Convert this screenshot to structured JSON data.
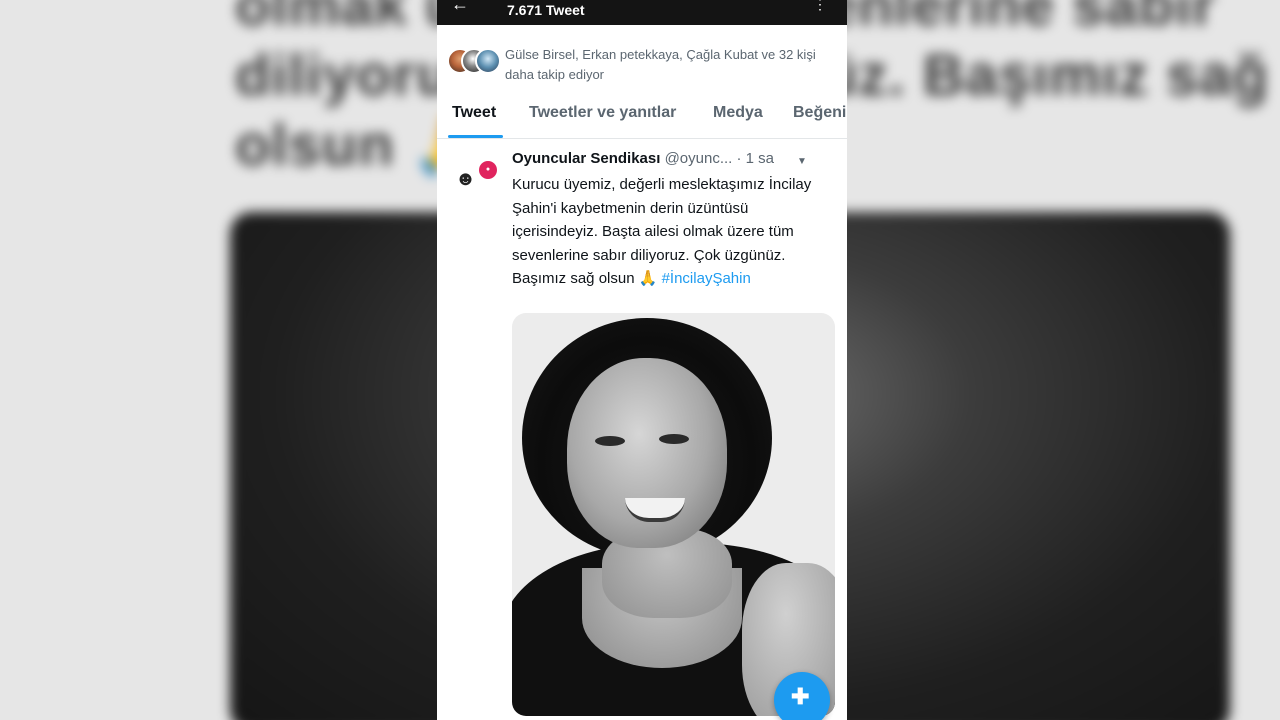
{
  "header": {
    "tweet_count": "7.671 Tweet"
  },
  "followers": {
    "text": "Gülse Birsel, Erkan petekkaya, Çağla Kubat ve 32 kişi daha takip ediyor"
  },
  "tabs": [
    {
      "label": "Tweet"
    },
    {
      "label": "Tweetler ve yanıtlar"
    },
    {
      "label": "Medya"
    },
    {
      "label": "Beğeni"
    }
  ],
  "tweet": {
    "name": "Oyuncular Sendikası",
    "handle": "@oyunc...",
    "separator": "·",
    "time": "1 sa",
    "body": "Kurucu üyemiz, değerli meslektaşımız İncilay Şahin'i kaybetmenin derin üzüntüsü içerisindeyiz. Başta ailesi olmak üzere tüm sevenlerine sabır diliyoruz. Çok üzgünüz. Başımız sağ olsun 🙏",
    "hashtag": "#İncilayŞahin"
  },
  "background": {
    "line1": "olmak üzere tüm sevenlerine sabır",
    "line2": "diliyoruz. Çok üzgünüz. Başımız sağ",
    "line3": "olsun 🙏"
  },
  "colors": {
    "accent": "#1d9bf0",
    "text_primary": "#0f1419",
    "text_secondary": "#5b6670"
  },
  "icons": {
    "back": "arrow-left-icon",
    "more": "more-vertical-icon",
    "compose": "compose-tweet-icon"
  }
}
